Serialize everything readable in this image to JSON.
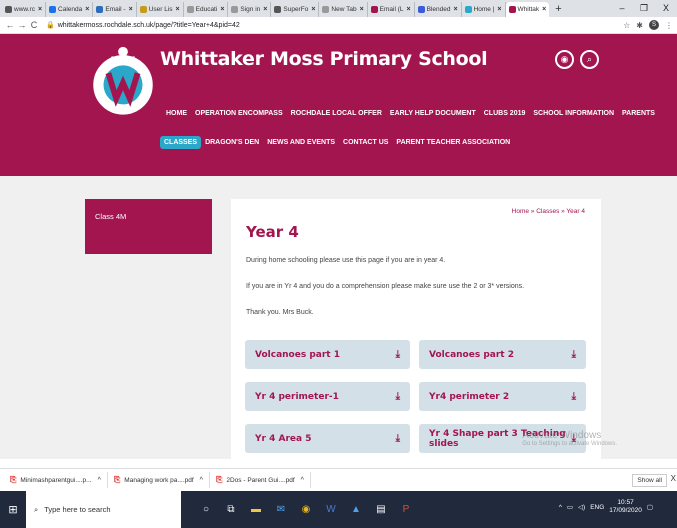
{
  "browser": {
    "tabs": [
      {
        "label": "www.rc",
        "color": "#555"
      },
      {
        "label": "Calenda",
        "color": "#1a73e8"
      },
      {
        "label": "Email -",
        "color": "#2a6ebb"
      },
      {
        "label": "User Lis",
        "color": "#c59b1a"
      },
      {
        "label": "Educati",
        "color": "#999"
      },
      {
        "label": "Sign in",
        "color": "#999"
      },
      {
        "label": "SuperFo",
        "color": "#555"
      },
      {
        "label": "New Tab",
        "color": "#999"
      },
      {
        "label": "Email (L",
        "color": "#a3154f"
      },
      {
        "label": "Blended",
        "color": "#3b5bdb"
      },
      {
        "label": "Home |",
        "color": "#2aa7c9"
      },
      {
        "label": "Whittak",
        "color": "#a3154f",
        "active": true
      }
    ],
    "new_tab": "+",
    "controls": {
      "min": "–",
      "max": "❐",
      "close": "X"
    },
    "url": "whittakermoss.rochdale.sch.uk/page/?title=Year+4&pid=42",
    "profile_initial": "S"
  },
  "site": {
    "title": "Whittaker Moss Primary School",
    "logo_text": "WHITTAKER MOSS SCHOOL",
    "nav_row1": [
      "HOME",
      "OPERATION ENCOMPASS",
      "ROCHDALE LOCAL OFFER",
      "EARLY HELP DOCUMENT",
      "CLUBS 2019",
      "SCHOOL INFORMATION",
      "PARENTS"
    ],
    "nav_row2": [
      "CLASSES",
      "DRAGON'S DEN",
      "NEWS AND EVENTS",
      "CONTACT US",
      "PARENT TEACHER ASSOCIATION"
    ],
    "active_nav": "CLASSES",
    "brand_color": "#a3154f",
    "accent_color": "#2aa7c9"
  },
  "sidebar": {
    "item": "Class 4M"
  },
  "page": {
    "breadcrumb": "Home » Classes » Year 4",
    "heading": "Year 4",
    "paragraphs": [
      "During home schooling please use this page if you are in year 4.",
      "If you are in Yr 4 and you do a comprehension please make sure use the 2 or 3* versions.",
      "Thank you. Mrs Buck."
    ],
    "downloads": [
      "Volcanoes part 1",
      "Volcanoes part 2",
      "Yr 4 perimeter-1",
      "Yr4 perimeter 2",
      "Yr 4 Area 5",
      "Yr 4 Shape part 3 Teaching slides"
    ]
  },
  "watermark": {
    "title": "Activate Windows",
    "sub": "Go to Settings to activate Windows."
  },
  "download_shelf": {
    "items": [
      "Minimashparentgui....p...",
      "Managing work pa....pdf",
      "2Dos - Parent Gui....pdf"
    ],
    "show_all": "Show all"
  },
  "taskbar": {
    "search_placeholder": "Type here to search",
    "lang": "ENG",
    "time": "10:57",
    "date": "17/09/2020"
  }
}
